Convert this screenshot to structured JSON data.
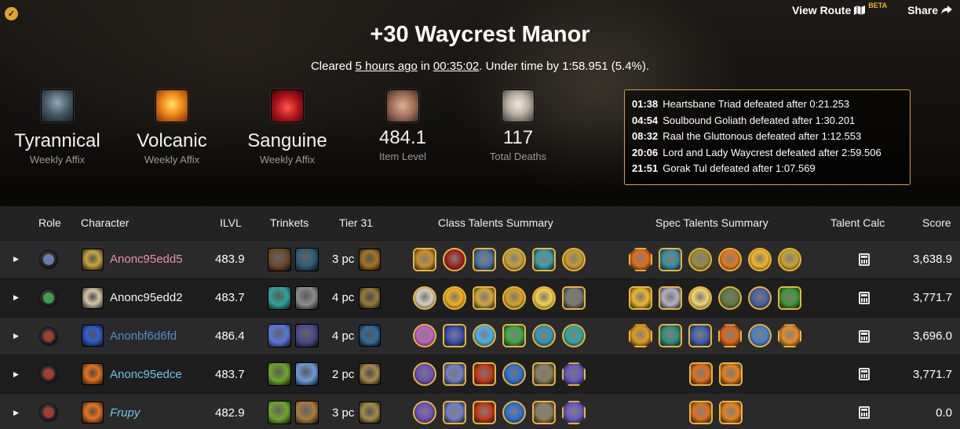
{
  "header": {
    "title": "+30 Waycrest Manor",
    "cleared_prefix": "Cleared ",
    "cleared_when": "5 hours ago",
    "cleared_in": " in ",
    "cleared_time": "00:35:02",
    "cleared_suffix": ". Under time by 1:58.951 (5.4%).",
    "view_route": "View Route",
    "beta": "BETA",
    "share": "Share"
  },
  "affixes": [
    {
      "name": "Tyrannical",
      "label": "Weekly Affix",
      "icon": "tyrannical-icon",
      "color": "#5a6c7a"
    },
    {
      "name": "Volcanic",
      "label": "Weekly Affix",
      "icon": "volcanic-icon",
      "color": "#e08a1a"
    },
    {
      "name": "Sanguine",
      "label": "Weekly Affix",
      "icon": "sanguine-icon",
      "color": "#b0151a"
    }
  ],
  "stats": [
    {
      "value": "484.1",
      "label": "Item Level",
      "icon": "arm-icon"
    },
    {
      "value": "117",
      "label": "Total Deaths",
      "icon": "skull-icon"
    }
  ],
  "bosses": [
    {
      "time": "01:38",
      "text": "Heartsbane Triad defeated after 0:21.253"
    },
    {
      "time": "04:54",
      "text": "Soulbound Goliath defeated after 1:30.201"
    },
    {
      "time": "08:32",
      "text": "Raal the Gluttonous defeated after 1:12.553"
    },
    {
      "time": "20:06",
      "text": "Lord and Lady Waycrest defeated after 2:59.506"
    },
    {
      "time": "21:51",
      "text": "Gorak Tul defeated after 1:07.569"
    }
  ],
  "columns": {
    "role": "Role",
    "character": "Character",
    "ilvl": "ILVL",
    "trinkets": "Trinkets",
    "tier": "Tier 31",
    "class_talents": "Class Talents Summary",
    "spec_talents": "Spec Talents Summary",
    "talent_calc": "Talent Calc",
    "score": "Score"
  },
  "rows": [
    {
      "role": "tank",
      "role_color": "#6f86c8",
      "name": "Anonc95edd5",
      "name_color": "#f28cba",
      "italic": false,
      "avatar_color": "#c9a53b",
      "ilvl": "483.9",
      "tier": "3 pc",
      "score": "3,638.9",
      "trinkets": [
        "#6b4a2a",
        "#2e5e78"
      ],
      "tier_icon": "#a6741e",
      "class_talents": [
        {
          "shape": "sq",
          "color": "#c7912d"
        },
        {
          "shape": "ci",
          "color": "#a52323"
        },
        {
          "shape": "sq",
          "color": "#4d73a3"
        },
        {
          "shape": "ci",
          "color": "#c7a13a"
        },
        {
          "shape": "sq",
          "color": "#3a9ea8"
        },
        {
          "shape": "ci",
          "color": "#c79b2e"
        }
      ],
      "spec_talents": [
        {
          "shape": "oc",
          "color": "#e36b1f"
        },
        {
          "shape": "sq",
          "color": "#3a8da0"
        },
        {
          "shape": "ci",
          "color": "#9c8a40"
        },
        {
          "shape": "ci",
          "color": "#e57621"
        },
        {
          "shape": "ci",
          "color": "#f0b826"
        },
        {
          "shape": "ci",
          "color": "#c4a530"
        }
      ]
    },
    {
      "role": "healer",
      "role_color": "#3db34f",
      "name": "Anonc95edd2",
      "name_color": "#f5f5f5",
      "italic": false,
      "avatar_color": "#d6c7a6",
      "ilvl": "483.7",
      "tier": "4 pc",
      "score": "3,771.7",
      "trinkets": [
        "#2fa39c",
        "#8b8b8b"
      ],
      "tier_icon": "#9a7a3a",
      "class_talents": [
        {
          "shape": "ci",
          "color": "#d9cfc0"
        },
        {
          "shape": "ci",
          "color": "#f2b21a"
        },
        {
          "shape": "sq",
          "color": "#d1a83e"
        },
        {
          "shape": "ci",
          "color": "#d6a325"
        },
        {
          "shape": "ci",
          "color": "#f5d34a"
        },
        {
          "shape": "sq",
          "color": "#7a7a70"
        }
      ],
      "spec_talents": [
        {
          "shape": "sq",
          "color": "#f0b82a"
        },
        {
          "shape": "sq",
          "color": "#b2b2c4"
        },
        {
          "shape": "ci",
          "color": "#f0d872"
        },
        {
          "shape": "ci",
          "color": "#5f7a3d"
        },
        {
          "shape": "ci",
          "color": "#4a5fa8"
        },
        {
          "shape": "sq",
          "color": "#3f9a3a"
        }
      ]
    },
    {
      "role": "dps",
      "role_color": "#b83a2a",
      "name": "Anonbf6d6fd",
      "name_color": "#4d8fd6",
      "italic": false,
      "avatar_color": "#2f5fcf",
      "ilvl": "486.4",
      "tier": "4 pc",
      "score": "3,696.0",
      "trinkets": [
        "#5878d9",
        "#4e4a8a"
      ],
      "tier_icon": "#2f6e9e",
      "class_talents": [
        {
          "shape": "ci",
          "color": "#c163c9"
        },
        {
          "shape": "sq",
          "color": "#3b4fb5"
        },
        {
          "shape": "ci",
          "color": "#4bb0e8"
        },
        {
          "shape": "sq",
          "color": "#3fa848"
        },
        {
          "shape": "ci",
          "color": "#2f97b8"
        },
        {
          "shape": "ci",
          "color": "#2ea6a0"
        }
      ],
      "spec_talents": [
        {
          "shape": "oc",
          "color": "#e29a1f"
        },
        {
          "shape": "sq",
          "color": "#2f8f80"
        },
        {
          "shape": "sq",
          "color": "#3f5fb0"
        },
        {
          "shape": "oc",
          "color": "#d9661e"
        },
        {
          "shape": "ci",
          "color": "#4a7ed0"
        },
        {
          "shape": "oc",
          "color": "#e88a2a"
        }
      ]
    },
    {
      "role": "dps",
      "role_color": "#b83a2a",
      "name": "Anonc95edce",
      "name_color": "#6fc4ea",
      "italic": false,
      "avatar_color": "#e8721e",
      "ilvl": "483.7",
      "tier": "2 pc",
      "score": "3,771.7",
      "trinkets": [
        "#6ea62a",
        "#6b9ad8"
      ],
      "tier_icon": "#a88a4a",
      "class_talents": [
        {
          "shape": "ci",
          "color": "#6f4fc0"
        },
        {
          "shape": "sq",
          "color": "#6f7fc8"
        },
        {
          "shape": "sq",
          "color": "#c43a1a"
        },
        {
          "shape": "ci",
          "color": "#2b6fcf"
        },
        {
          "shape": "sq",
          "color": "#8a8060"
        },
        {
          "shape": "oc",
          "color": "#6a5ac2"
        }
      ],
      "spec_talents": [
        {
          "shape": "sq",
          "color": "#e0701e"
        },
        {
          "shape": "sq",
          "color": "#e8801e"
        }
      ]
    },
    {
      "role": "dps",
      "role_color": "#b83a2a",
      "name": "Frupy",
      "name_color": "#6fc4ea",
      "italic": true,
      "avatar_color": "#e8721e",
      "ilvl": "482.9",
      "tier": "3 pc",
      "score": "0.0",
      "trinkets": [
        "#6ea62a",
        "#a87a3a"
      ],
      "tier_icon": "#a88a4a",
      "class_talents": [
        {
          "shape": "ci",
          "color": "#6f4fc0"
        },
        {
          "shape": "sq",
          "color": "#6f7fc8"
        },
        {
          "shape": "sq",
          "color": "#c43a1a"
        },
        {
          "shape": "ci",
          "color": "#2b6fcf"
        },
        {
          "shape": "sq",
          "color": "#8a8060"
        },
        {
          "shape": "oc",
          "color": "#6a5ac2"
        }
      ],
      "spec_talents": [
        {
          "shape": "sq",
          "color": "#e0701e"
        },
        {
          "shape": "sq",
          "color": "#e8801e"
        }
      ]
    }
  ]
}
